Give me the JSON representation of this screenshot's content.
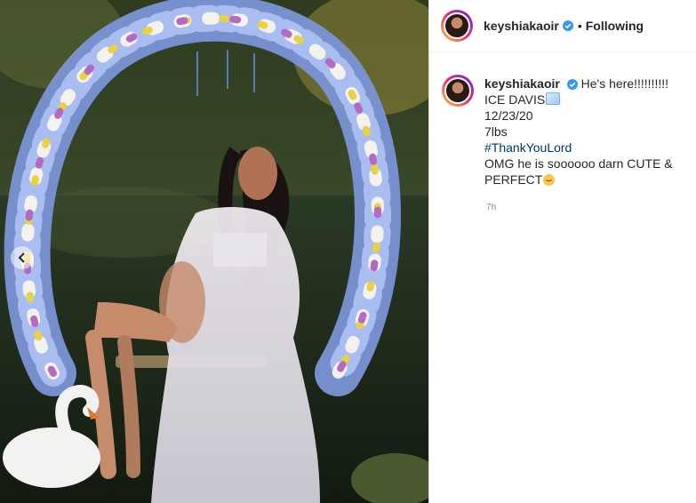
{
  "post": {
    "username": "keyshiakaoir",
    "follow_state": "Following",
    "separator": "•",
    "caption": {
      "headline": "He's here!!!!!!!!!!",
      "lines": [
        "ICE DAVIS",
        "12/23/20",
        "7lbs",
        "#ThankYouLord",
        "OMG he is soooooo darn CUTE &",
        "PERFECT"
      ]
    },
    "timestamp": "7h"
  },
  "colors": {
    "verified_badge": "#3897f0",
    "hashtag": "#00376b",
    "avatar_ring": "#ee2a7b"
  },
  "icons": {
    "verified": "verified-badge-icon",
    "carousel_prev": "chevron-left-icon",
    "ice": "ice-cube-emoji",
    "baby": "baby-emoji"
  }
}
